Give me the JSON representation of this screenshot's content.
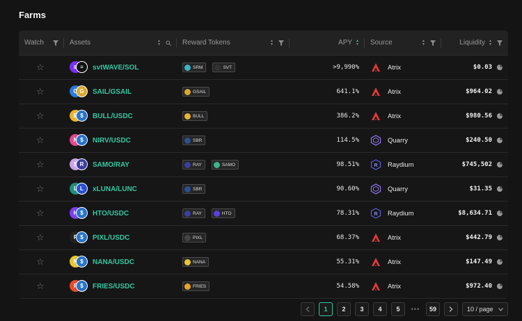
{
  "page_title": "Farms",
  "columns": {
    "watch": "Watch",
    "assets": "Assets",
    "reward_tokens": "Reward Tokens",
    "apy": "APY",
    "source": "Source",
    "liquidity": "Liquidity"
  },
  "rows": [
    {
      "pair": "svtWAVE/SOL",
      "logo_a": {
        "text": "≋",
        "color": "#7b2ff7"
      },
      "logo_b": {
        "text": "≡",
        "color": "#111"
      },
      "tokens": [
        {
          "label": "SRM",
          "color": "#3bb4c8"
        },
        {
          "label": "SVT",
          "color": "#333"
        }
      ],
      "apy": ">9,990%",
      "source": "Atrix",
      "source_icon": "atrix",
      "liquidity": "$0.03"
    },
    {
      "pair": "SAIL/GSAIL",
      "logo_a": {
        "text": "G",
        "color": "#2a7bd9"
      },
      "logo_b": {
        "text": "G",
        "color": "#d9a82a"
      },
      "tokens": [
        {
          "label": "GSAIL",
          "color": "#d9a82a"
        }
      ],
      "apy": "641.1%",
      "source": "Atrix",
      "source_icon": "atrix",
      "liquidity": "$964.02"
    },
    {
      "pair": "BULL/USDC",
      "logo_a": {
        "text": "B",
        "color": "#e8b431"
      },
      "logo_b": {
        "text": "$",
        "color": "#2775ca"
      },
      "tokens": [
        {
          "label": "BULL",
          "color": "#e8b431"
        }
      ],
      "apy": "386.2%",
      "source": "Atrix",
      "source_icon": "atrix",
      "liquidity": "$980.56"
    },
    {
      "pair": "NIRV/USDC",
      "logo_a": {
        "text": "N",
        "color": "#e34b8c"
      },
      "logo_b": {
        "text": "$",
        "color": "#2775ca"
      },
      "tokens": [
        {
          "label": "SBR",
          "color": "#2c4f91"
        }
      ],
      "apy": "114.5%",
      "source": "Quarry",
      "source_icon": "quarry",
      "liquidity": "$240.50"
    },
    {
      "pair": "SAMO/RAY",
      "logo_a": {
        "text": "S",
        "color": "#c9a4e6"
      },
      "logo_b": {
        "text": "R",
        "color": "#3a3f9e"
      },
      "tokens": [
        {
          "label": "RAY",
          "color": "#3a3f9e"
        },
        {
          "label": "SAMO",
          "color": "#3bb48c"
        }
      ],
      "apy": "98.51%",
      "source": "Raydium",
      "source_icon": "raydium",
      "liquidity": "$745,502"
    },
    {
      "pair": "xLUNA/LUNC",
      "logo_a": {
        "text": "L",
        "color": "#1f8f7a"
      },
      "logo_b": {
        "text": "L",
        "color": "#2b4fd1"
      },
      "tokens": [
        {
          "label": "SBR",
          "color": "#2c4f91"
        }
      ],
      "apy": "90.60%",
      "source": "Quarry",
      "source_icon": "quarry",
      "liquidity": "$31.35"
    },
    {
      "pair": "HTO/USDC",
      "logo_a": {
        "text": "H",
        "color": "#7b3ff2"
      },
      "logo_b": {
        "text": "$",
        "color": "#2775ca"
      },
      "tokens": [
        {
          "label": "RAY",
          "color": "#3a3f9e"
        },
        {
          "label": "HTO",
          "color": "#5b3fe0"
        }
      ],
      "apy": "78.31%",
      "source": "Raydium",
      "source_icon": "raydium",
      "liquidity": "$8,634.71"
    },
    {
      "pair": "PIXL/USDC",
      "logo_a": {
        "text": "P",
        "color": "#222"
      },
      "logo_b": {
        "text": "$",
        "color": "#2775ca"
      },
      "tokens": [
        {
          "label": "PIXL",
          "color": "#444"
        }
      ],
      "apy": "68.37%",
      "source": "Atrix",
      "source_icon": "atrix",
      "liquidity": "$442.79"
    },
    {
      "pair": "NANA/USDC",
      "logo_a": {
        "text": "N",
        "color": "#e8c531"
      },
      "logo_b": {
        "text": "$",
        "color": "#2775ca"
      },
      "tokens": [
        {
          "label": "NANA",
          "color": "#e8c531"
        }
      ],
      "apy": "55.31%",
      "source": "Atrix",
      "source_icon": "atrix",
      "liquidity": "$147.49"
    },
    {
      "pair": "FRIES/USDC",
      "logo_a": {
        "text": "F",
        "color": "#e84a2a"
      },
      "logo_b": {
        "text": "$",
        "color": "#2775ca"
      },
      "tokens": [
        {
          "label": "FRIES",
          "color": "#e8a42a"
        }
      ],
      "apy": "54.58%",
      "source": "Atrix",
      "source_icon": "atrix",
      "liquidity": "$972.40"
    }
  ],
  "pagination": {
    "pages": [
      "1",
      "2",
      "3",
      "4",
      "5"
    ],
    "ellipsis": "•••",
    "last_page": "59",
    "current": "1",
    "per_page": "10 / page"
  },
  "colors": {
    "accent": "#35c7a2",
    "atrix": "#e23b3b",
    "quarry": "#8a6fe0",
    "raydium": "#5a5fe0"
  }
}
